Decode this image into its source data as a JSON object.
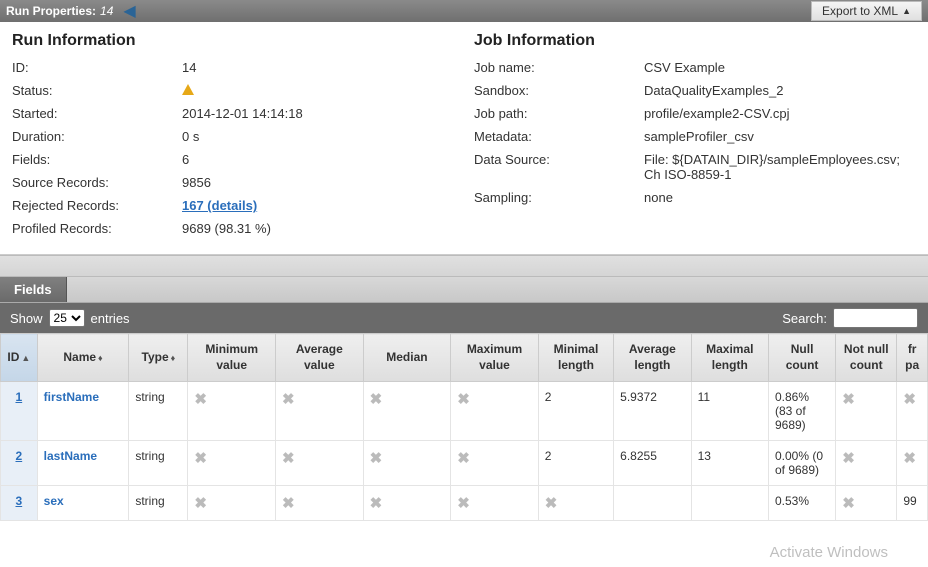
{
  "header": {
    "title": "Run Properties:",
    "run_num": "14",
    "export_label": "Export to XML"
  },
  "run_info": {
    "heading": "Run Information",
    "rows": {
      "id": {
        "label": "ID:",
        "value": "14"
      },
      "status": {
        "label": "Status:",
        "value": ""
      },
      "started": {
        "label": "Started:",
        "value": "2014-12-01 14:14:18"
      },
      "duration": {
        "label": "Duration:",
        "value": "0 s"
      },
      "fields": {
        "label": "Fields:",
        "value": "6"
      },
      "source": {
        "label": "Source Records:",
        "value": "9856"
      },
      "rejected": {
        "label": "Rejected Records:",
        "value": "167 (details)"
      },
      "profiled": {
        "label": "Profiled Records:",
        "value": "9689 (98.31 %)"
      }
    }
  },
  "job_info": {
    "heading": "Job Information",
    "rows": {
      "jobname": {
        "label": "Job name:",
        "value": "CSV Example"
      },
      "sandbox": {
        "label": "Sandbox:",
        "value": "DataQualityExamples_2"
      },
      "jobpath": {
        "label": "Job path:",
        "value": "profile/example2-CSV.cpj"
      },
      "metadata": {
        "label": "Metadata:",
        "value": "sampleProfiler_csv"
      },
      "datasource": {
        "label": "Data Source:",
        "value": "File: ${DATAIN_DIR}/sampleEmployees.csv; Ch ISO-8859-1"
      },
      "sampling": {
        "label": "Sampling:",
        "value": "none"
      }
    }
  },
  "fields_section": {
    "tab_label": "Fields",
    "show_label": "Show",
    "entries_label": "entries",
    "entries_value": "25",
    "search_label": "Search:",
    "columns": {
      "id": "ID",
      "name": "Name",
      "type": "Type",
      "min": "Minimum value",
      "avg": "Average value",
      "median": "Median",
      "max": "Maximum value",
      "minl": "Minimal length",
      "avgl": "Average length",
      "maxl": "Maximal length",
      "null": "Null count",
      "nnull": "Not null count",
      "fr": "fr pa"
    },
    "rows": [
      {
        "id": "1",
        "name": "firstName",
        "type": "string",
        "min": "x",
        "avg": "x",
        "median": "x",
        "max": "x",
        "minl": "2",
        "avgl": "5.9372",
        "maxl": "11",
        "null": "0.86% (83 of 9689)",
        "nnull": "x",
        "fr": "x"
      },
      {
        "id": "2",
        "name": "lastName",
        "type": "string",
        "min": "x",
        "avg": "x",
        "median": "x",
        "max": "x",
        "minl": "2",
        "avgl": "6.8255",
        "maxl": "13",
        "null": "0.00% (0 of 9689)",
        "nnull": "x",
        "fr": "x"
      },
      {
        "id": "3",
        "name": "sex",
        "type": "string",
        "min": "x",
        "avg": "x",
        "median": "x",
        "max": "x",
        "minl": "x",
        "avgl": "",
        "maxl": "",
        "null": "0.53%",
        "nnull": "x",
        "fr": "99"
      }
    ]
  },
  "watermark": "Activate Windows"
}
